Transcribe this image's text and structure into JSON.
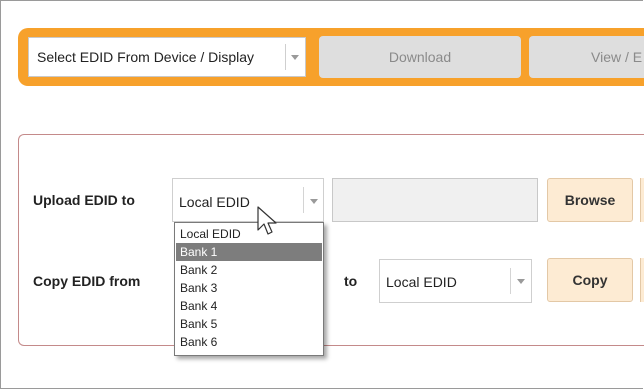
{
  "toolbar": {
    "device_select_value": "Select EDID From Device / Display",
    "download_label": "Download",
    "view_label": "View / E"
  },
  "upload_row": {
    "label": "Upload EDID to",
    "target_value": "Local EDID",
    "file_path_value": "",
    "browse_label": "Browse"
  },
  "copy_row": {
    "label": "Copy EDID from",
    "to_label": "to",
    "target_value": "Local EDID",
    "copy_label": "Copy"
  },
  "dropdown": {
    "options": [
      "Local EDID",
      "Bank 1",
      "Bank 2",
      "Bank 3",
      "Bank 4",
      "Bank 5",
      "Bank 6"
    ],
    "highlighted": "Bank 1"
  },
  "colors": {
    "toolbar_accent": "#f7a12b",
    "panel_border": "#c48a8a",
    "action_button_bg": "#fdebd3"
  },
  "icons": {
    "dropdown_arrow": "chevron-down-icon",
    "pointer": "mouse-pointer-icon"
  }
}
